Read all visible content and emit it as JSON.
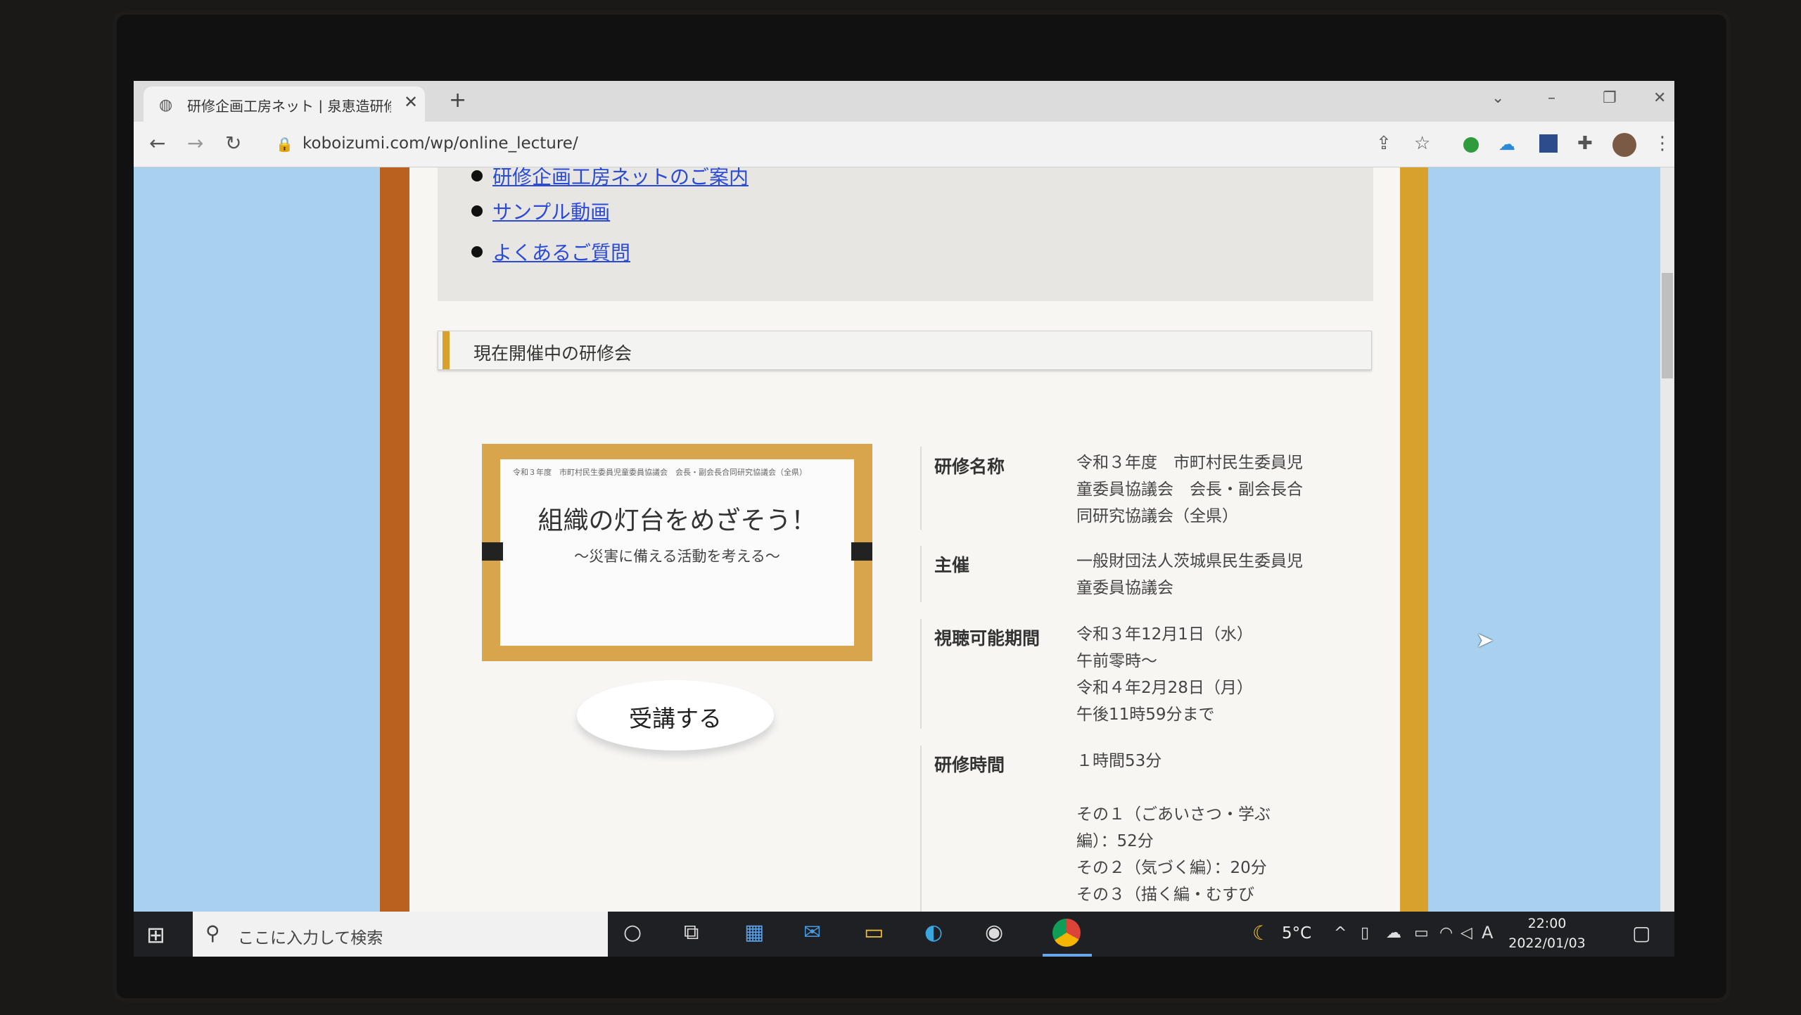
{
  "browser": {
    "tab_title": "研修企画工房ネット | 泉恵造研修",
    "tab_close": "✕",
    "new_tab": "+",
    "url": "koboizumi.com/wp/online_lecture/"
  },
  "page": {
    "menu_links": [
      "研修企画工房ネットのご案内",
      "サンプル動画",
      "よくあるご質問"
    ],
    "section_heading": "現在開催中の研修会",
    "thumbnail": {
      "small_header": "令和３年度　市町村民生委員児童委員協議会　会長・副会長合同研究協議会（全県）",
      "title": "組織の灯台をめざそう！",
      "subtitle": "～災害に備える活動を考える～"
    },
    "enroll_button": "受講する",
    "details": [
      {
        "label": "研修名称",
        "lines": [
          "令和３年度　市町村民生委員児",
          "童委員協議会　会長・副会長合",
          "同研究協議会（全県）"
        ]
      },
      {
        "label": "主催",
        "lines": [
          "一般財団法人茨城県民生委員児",
          "童委員協議会"
        ]
      },
      {
        "label": "視聴可能期間",
        "lines": [
          "令和３年12月1日（水）",
          "午前零時～",
          "令和４年2月28日（月）",
          "午後11時59分まで"
        ]
      },
      {
        "label": "研修時間",
        "lines": [
          "１時間53分",
          "",
          "その１（ごあいさつ・学ぶ",
          "編）：52分",
          "その２（気づく編）：20分",
          "その３（描く編・むすび"
        ]
      }
    ]
  },
  "taskbar": {
    "search_placeholder": "ここに入力して検索",
    "temperature": "5°C",
    "time": "22:00",
    "date": "2022/01/03",
    "ime": "A"
  }
}
